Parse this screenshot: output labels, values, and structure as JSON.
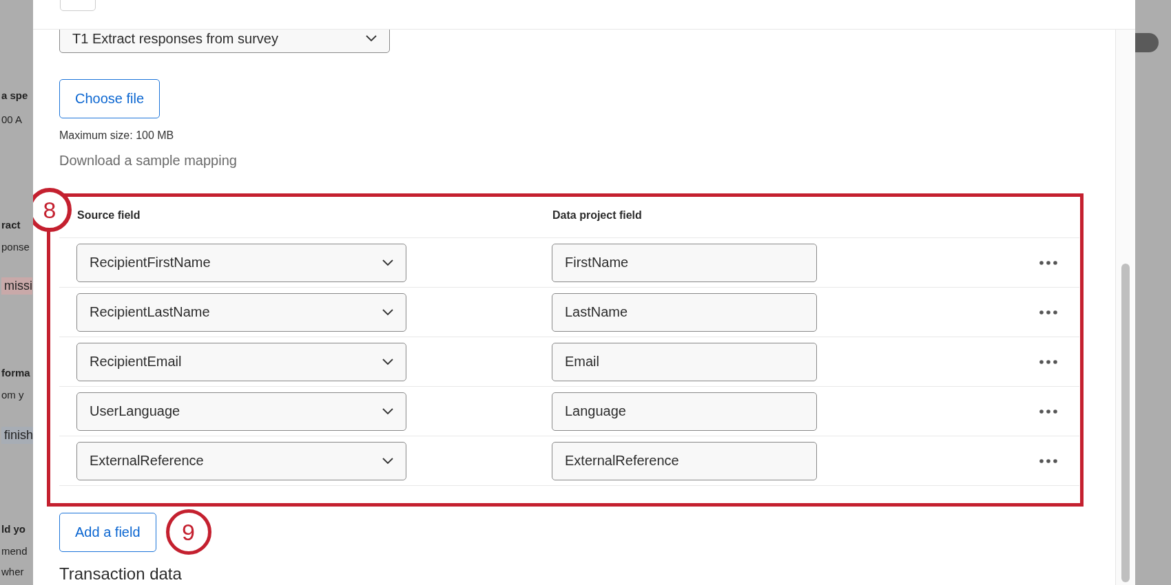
{
  "background_page": {
    "fragments": [
      {
        "text": "a spe",
        "kind": "title"
      },
      {
        "text": "00 A",
        "kind": "text"
      },
      {
        "text": "ract",
        "kind": "title"
      },
      {
        "text": "ponse",
        "kind": "text"
      },
      {
        "text": "missi",
        "kind": "error"
      },
      {
        "text": "forma",
        "kind": "title"
      },
      {
        "text": "om y",
        "kind": "text"
      },
      {
        "text": "finish",
        "kind": "info"
      },
      {
        "text": "ld yo",
        "kind": "title"
      },
      {
        "text": "mend",
        "kind": "text"
      },
      {
        "text": "wher",
        "kind": "text"
      }
    ],
    "toggle": {
      "on": true
    }
  },
  "dialog": {
    "task_select": {
      "value": "T1 Extract responses from survey"
    },
    "choose_file_button": "Choose file",
    "max_size_note": "Maximum size: 100 MB",
    "sample_link": "Download a sample mapping",
    "mapping": {
      "columns": [
        "Source field",
        "Data project field"
      ],
      "rows": [
        {
          "source": "RecipientFirstName",
          "target": "FirstName"
        },
        {
          "source": "RecipientLastName",
          "target": "LastName"
        },
        {
          "source": "RecipientEmail",
          "target": "Email"
        },
        {
          "source": "UserLanguage",
          "target": "Language"
        },
        {
          "source": "ExternalReference",
          "target": "ExternalReference"
        }
      ]
    },
    "add_field_button": "Add a field",
    "next_section_heading": "Transaction data"
  },
  "callouts": [
    "8",
    "9"
  ]
}
